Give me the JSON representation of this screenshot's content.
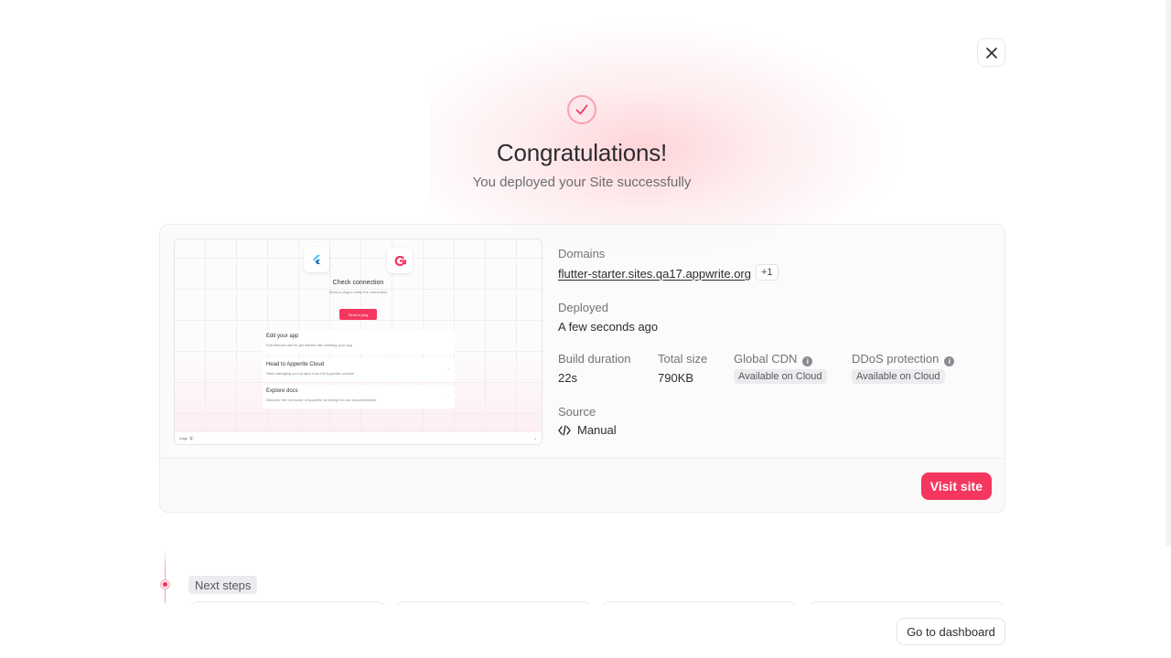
{
  "header": {
    "title": "Congratulations!",
    "subtitle": "You deployed your Site successfully"
  },
  "preview": {
    "title": "Check connection",
    "subtitle": "Send a ping to verify the connection",
    "button_label": "Send a ping",
    "rows": [
      {
        "heading": "Edit your app",
        "desc": "Edit lib/main.dart to get started with building your app"
      },
      {
        "heading": "Head to Appwrite Cloud",
        "desc": "Start managing your project from the Appwrite console"
      },
      {
        "heading": "Explore docs",
        "desc": "Discover the full power of Appwrite by diving into our documentation"
      }
    ],
    "bar_left": "Logs",
    "bar_badge": "0"
  },
  "details": {
    "domains_label": "Domains",
    "domain": "flutter-starter.sites.qa17.appwrite.org",
    "domain_extra": "+1",
    "deployed_label": "Deployed",
    "deployed_value": "A few seconds ago",
    "build_duration_label": "Build duration",
    "build_duration_value": "22s",
    "total_size_label": "Total size",
    "total_size_value": "790KB",
    "global_cdn_label": "Global CDN",
    "global_cdn_value": "Available on Cloud",
    "ddos_label": "DDoS protection",
    "ddos_value": "Available on Cloud",
    "source_label": "Source",
    "source_value": "Manual"
  },
  "actions": {
    "visit_site": "Visit site",
    "go_to_dashboard": "Go to dashboard"
  },
  "next_steps": {
    "label": "Next steps"
  },
  "icons": {
    "close": "close-icon",
    "success": "check-circle-icon",
    "source": "code-icon",
    "info": "info-icon"
  },
  "colors": {
    "accent": "#f5365f",
    "text": "#2d2d31",
    "muted": "#737378"
  }
}
